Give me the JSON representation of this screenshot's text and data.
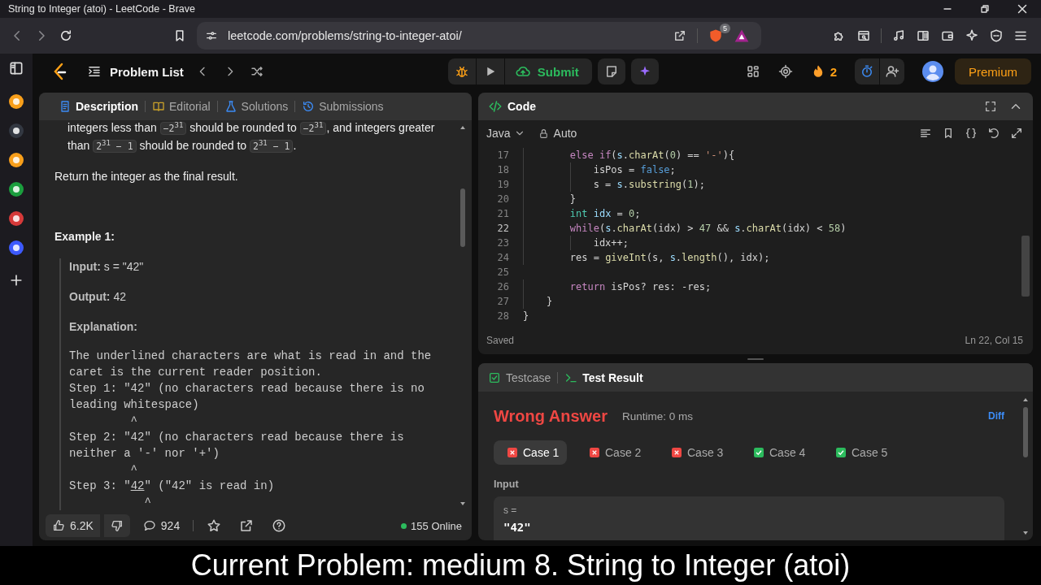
{
  "window": {
    "title": "String to Integer (atoi) - LeetCode - Brave"
  },
  "browser": {
    "url": "leetcode.com/problems/string-to-integer-atoi/",
    "shields_count": "5"
  },
  "header": {
    "problem_list": "Problem List",
    "submit": "Submit",
    "streak": "2",
    "premium": "Premium"
  },
  "description": {
    "tabs": [
      {
        "label": "Description",
        "selected": true
      },
      {
        "label": "Editorial",
        "selected": false
      },
      {
        "label": "Solutions",
        "selected": false
      },
      {
        "label": "Submissions",
        "selected": false
      }
    ],
    "paragraphs": [
      {
        "kind": "indented",
        "segments": [
          "integers less than ",
          {
            "code": "−2$^{31}$"
          },
          " should be rounded to ",
          {
            "code": "−2$^{31}$"
          },
          ", and integers greater than ",
          {
            "code": "2$^{31}$ − 1"
          },
          " should be rounded to ",
          {
            "code": "2$^{31}$ − 1"
          },
          "."
        ]
      },
      {
        "kind": "plain",
        "segments": [
          "Return the integer as the final result."
        ]
      }
    ],
    "example": {
      "title": "Example 1:",
      "input": "**Input:** s = \"42\"",
      "output": "**Output:** 42",
      "explanation_label": "Explanation:",
      "explanation_lines": [
        [
          "The underlined characters are what is read in and the"
        ],
        [
          "caret is the current reader position."
        ],
        [
          "Step 1: \"42\" (no characters read because there is no"
        ],
        [
          "leading whitespace)"
        ],
        [
          "         ^"
        ],
        [
          "Step 2: \"42\" (no characters read because there is"
        ],
        [
          "neither a '-' nor '+')"
        ],
        [
          "         ^"
        ],
        [
          "Step 3: \"",
          {
            "text": "42",
            "underlined": true
          },
          "\" (\"42\" is read in)"
        ],
        [
          "           ^"
        ]
      ]
    },
    "footer": {
      "likes": "6.2K",
      "comments": "924",
      "online": "155 Online"
    }
  },
  "code": {
    "title": "Code",
    "language": "Java",
    "mode": "Auto",
    "status": "Saved",
    "position": "Ln 22, Col 15",
    "lines": [
      {
        "number": "17",
        "current": false,
        "tokens": [
          {
            "kind": "kw",
            "text": "        else if"
          },
          {
            "kind": "p",
            "text": "("
          },
          {
            "kind": "v",
            "text": "s"
          },
          {
            "kind": "p",
            "text": "."
          },
          {
            "kind": "fn",
            "text": "charAt"
          },
          {
            "kind": "p",
            "text": "("
          },
          {
            "kind": "num",
            "text": "0"
          },
          {
            "kind": "p",
            "text": ") == "
          },
          {
            "kind": "str",
            "text": "'-'"
          },
          {
            "kind": "p",
            "text": "){"
          }
        ]
      },
      {
        "number": "18",
        "current": false,
        "tokens": [
          {
            "kind": "p",
            "text": "            isPos = "
          },
          {
            "kind": "bool",
            "text": "false"
          },
          {
            "kind": "p",
            "text": ";"
          }
        ]
      },
      {
        "number": "19",
        "current": false,
        "tokens": [
          {
            "kind": "p",
            "text": "            s = "
          },
          {
            "kind": "v",
            "text": "s"
          },
          {
            "kind": "p",
            "text": "."
          },
          {
            "kind": "fn",
            "text": "substring"
          },
          {
            "kind": "p",
            "text": "("
          },
          {
            "kind": "num",
            "text": "1"
          },
          {
            "kind": "p",
            "text": ");"
          }
        ]
      },
      {
        "number": "20",
        "current": false,
        "tokens": [
          {
            "kind": "p",
            "text": "        }"
          }
        ]
      },
      {
        "number": "21",
        "current": false,
        "tokens": [
          {
            "kind": "type",
            "text": "        int "
          },
          {
            "kind": "v",
            "text": "idx"
          },
          {
            "kind": "p",
            "text": " = "
          },
          {
            "kind": "num",
            "text": "0"
          },
          {
            "kind": "p",
            "text": ";"
          }
        ]
      },
      {
        "number": "22",
        "current": true,
        "tokens": [
          {
            "kind": "kw",
            "text": "        while"
          },
          {
            "kind": "p",
            "text": "("
          },
          {
            "kind": "v",
            "text": "s"
          },
          {
            "kind": "p",
            "text": "."
          },
          {
            "kind": "fn",
            "text": "charAt"
          },
          {
            "kind": "p",
            "text": "(idx) > "
          },
          {
            "kind": "num",
            "text": "47"
          },
          {
            "kind": "p",
            "text": " && "
          },
          {
            "kind": "v",
            "text": "s"
          },
          {
            "kind": "p",
            "text": "."
          },
          {
            "kind": "fn",
            "text": "charAt"
          },
          {
            "kind": "p",
            "text": "(idx) < "
          },
          {
            "kind": "num",
            "text": "58"
          },
          {
            "kind": "p",
            "text": ")"
          }
        ]
      },
      {
        "number": "23",
        "current": false,
        "tokens": [
          {
            "kind": "p",
            "text": "            idx++;"
          }
        ]
      },
      {
        "number": "24",
        "current": false,
        "tokens": [
          {
            "kind": "p",
            "text": "        res = "
          },
          {
            "kind": "fn",
            "text": "giveInt"
          },
          {
            "kind": "p",
            "text": "(s, "
          },
          {
            "kind": "v",
            "text": "s"
          },
          {
            "kind": "p",
            "text": "."
          },
          {
            "kind": "fn",
            "text": "length"
          },
          {
            "kind": "p",
            "text": "(), idx);"
          }
        ]
      },
      {
        "number": "25",
        "current": false
      },
      {
        "number": "26",
        "current": false,
        "tokens": [
          {
            "kind": "kw",
            "text": "        return"
          },
          {
            "kind": "p",
            "text": " isPos? res: -res;"
          }
        ]
      },
      {
        "number": "27",
        "current": false,
        "tokens": [
          {
            "kind": "p",
            "text": "    }"
          }
        ]
      },
      {
        "number": "28",
        "current": false,
        "tokens": [
          {
            "kind": "p",
            "text": "}"
          }
        ]
      }
    ]
  },
  "result": {
    "tabs": [
      {
        "label": "Testcase",
        "selected": false
      },
      {
        "label": "Test Result",
        "selected": true
      }
    ],
    "status": {
      "text": "Wrong Answer",
      "kind": "wrong"
    },
    "runtime": "Runtime: 0 ms",
    "diff": "Diff",
    "cases": [
      {
        "label": "Case 1",
        "passed": false,
        "selected": true
      },
      {
        "label": "Case 2",
        "passed": false,
        "selected": false
      },
      {
        "label": "Case 3",
        "passed": false,
        "selected": false
      },
      {
        "label": "Case 4",
        "passed": true,
        "selected": false
      },
      {
        "label": "Case 5",
        "passed": true,
        "selected": false
      }
    ],
    "input_label": "Input",
    "input_name": "s =",
    "input_value": "\"42\""
  },
  "caption": "Current Problem: medium 8. String to Integer (atoi)"
}
